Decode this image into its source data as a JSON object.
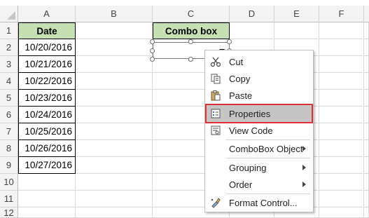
{
  "columns": [
    "A",
    "B",
    "C",
    "D",
    "E",
    "F"
  ],
  "rows": [
    "1",
    "2",
    "3",
    "4",
    "5",
    "6",
    "7",
    "8",
    "9",
    "10",
    "11",
    "12"
  ],
  "cells": {
    "a1": "Date",
    "c1": "Combo box",
    "dates": [
      "10/20/2016",
      "10/21/2016",
      "10/22/2016",
      "10/23/2016",
      "10/24/2016",
      "10/25/2016",
      "10/26/2016",
      "10/27/2016"
    ]
  },
  "menu": {
    "cut": "Cut",
    "copy": "Copy",
    "paste": "Paste",
    "properties": "Properties",
    "view_code": "View Code",
    "combobox_object": "ComboBox Object",
    "grouping": "Grouping",
    "order": "Order",
    "format_control": "Format Control..."
  },
  "colors": {
    "header_fill": "#c6e0b4",
    "highlight_outline": "#e0303a"
  },
  "icons": {
    "cut": "scissors-icon",
    "copy": "copy-icon",
    "paste": "paste-icon",
    "properties": "properties-icon",
    "view_code": "view-code-icon",
    "format_control": "format-control-icon"
  }
}
